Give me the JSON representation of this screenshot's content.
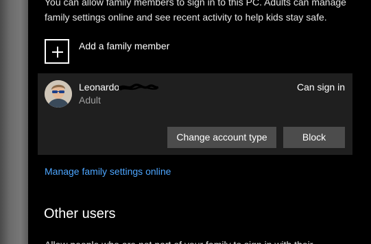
{
  "family": {
    "intro_line1": "You can allow family members to sign in to this PC. Adults can manage",
    "intro_line2": "family settings online and see recent activity to help kids stay safe.",
    "add_member_label": "Add a family member",
    "member": {
      "name": "Leonardo",
      "role": "Adult",
      "status": "Can sign in",
      "change_account_type_label": "Change account type",
      "block_label": "Block"
    },
    "manage_link": "Manage family settings online"
  },
  "other_users": {
    "title": "Other users",
    "description": "Allow people who are not part of your family to sign in with their"
  },
  "colors": {
    "background": "#000000",
    "card": "#1f1f1f",
    "button": "#4c4c4c",
    "link": "#4da6ff",
    "secondary_text": "#a0a0a0"
  },
  "icons": {
    "add": "plus-icon",
    "avatar": "user-avatar"
  }
}
